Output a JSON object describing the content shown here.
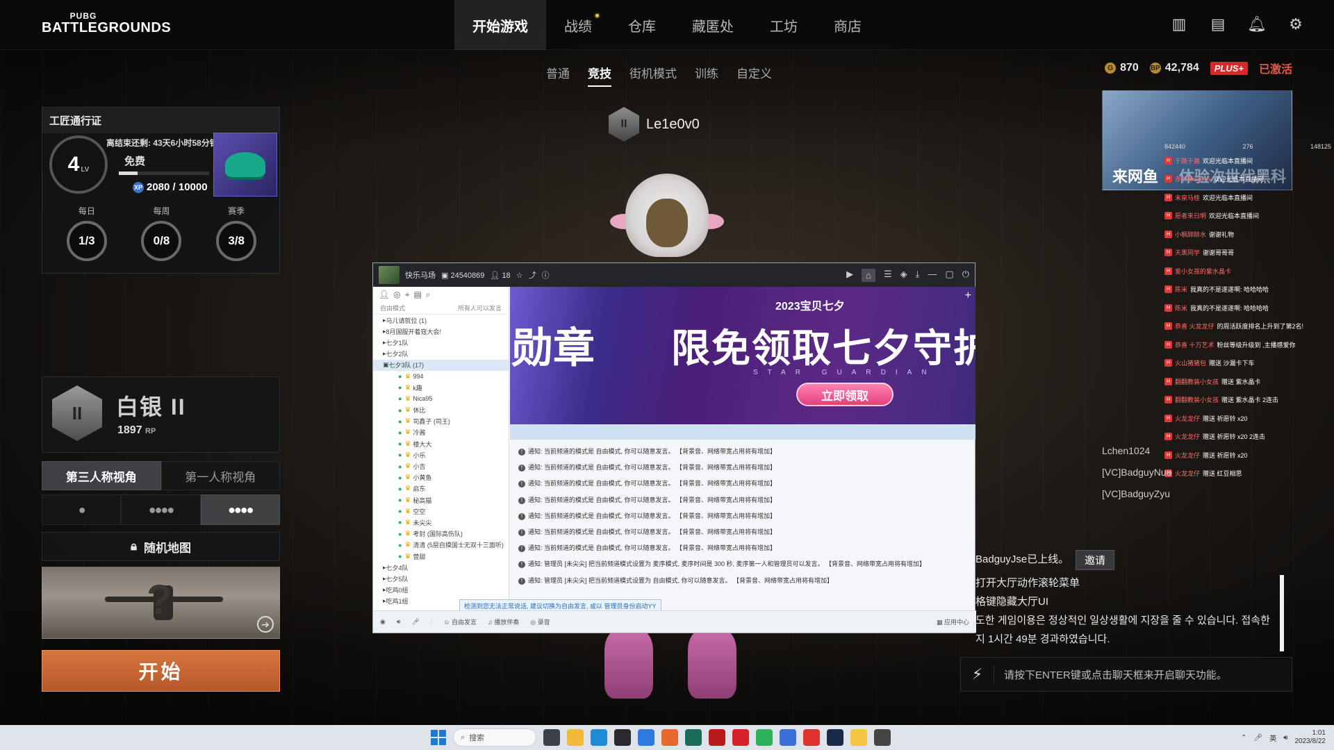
{
  "brand": {
    "line1": "PUBG",
    "line2": "BATTLEGROUNDS"
  },
  "nav": {
    "items": [
      {
        "label": "开始游戏",
        "active": true
      },
      {
        "label": "战绩",
        "active": false,
        "notify": true
      },
      {
        "label": "仓库",
        "active": false
      },
      {
        "label": "藏匿处",
        "active": false
      },
      {
        "label": "工坊",
        "active": false
      },
      {
        "label": "商店",
        "active": false
      }
    ]
  },
  "sub_nav": {
    "items": [
      "普通",
      "竞技",
      "街机模式",
      "训练",
      "自定义"
    ],
    "active": "竞技"
  },
  "top_icons": [
    "store-gift-icon",
    "missions-icon",
    "bell-icon",
    "gear-icon"
  ],
  "currency": {
    "gcoin": "870",
    "bp": "42,784",
    "plus_label": "PLUS+",
    "plus_status": "已激活"
  },
  "survivor_pass": {
    "title": "工匠通行证",
    "end_notice": "离结束还剩: 43天6小时58分钟",
    "level": "4",
    "level_suffix": "LV",
    "tier": "免费",
    "xp": "2080 / 10000",
    "xp_fraction": 0.208,
    "missions": [
      {
        "label": "每日",
        "progress": "1/3"
      },
      {
        "label": "每周",
        "progress": "0/8"
      },
      {
        "label": "赛季",
        "progress": "3/8"
      }
    ]
  },
  "player": {
    "name": "Le1e0v0",
    "emblem": "II"
  },
  "rank": {
    "tier": "白银 II",
    "emblem": "II",
    "rp": "1897",
    "rp_unit": "RP"
  },
  "perspective": {
    "options": [
      "第三人称视角",
      "第一人称视角"
    ],
    "active": "第三人称视角"
  },
  "squad": {
    "options": [
      "solo",
      "squad-4",
      "squad-4-active"
    ],
    "active_index": 2
  },
  "map": {
    "label": "随机地图"
  },
  "start": {
    "label": "开始"
  },
  "yy": {
    "title_bar": {
      "channel": "快乐马场",
      "id": "24540869",
      "members": "18"
    },
    "mode_left": "自由模式",
    "mode_right": "所有人可以发言",
    "tree": [
      {
        "text": "马儿请就位 (1)",
        "type": "group"
      },
      {
        "text": "8月国服开着寇大会!",
        "type": "group"
      },
      {
        "text": "七夕1队",
        "type": "group"
      },
      {
        "text": "七夕2队",
        "type": "group"
      },
      {
        "text": "七夕3队 (17)",
        "type": "group",
        "selected": true
      },
      {
        "text": "994",
        "type": "member"
      },
      {
        "text": "k趣",
        "type": "member"
      },
      {
        "text": "Nica95",
        "type": "member"
      },
      {
        "text": "休比",
        "type": "member"
      },
      {
        "text": "司鑫子 (司王)",
        "type": "member"
      },
      {
        "text": "冷酱",
        "type": "member"
      },
      {
        "text": "楼大大",
        "type": "member"
      },
      {
        "text": "小乐",
        "type": "member"
      },
      {
        "text": "小吉",
        "type": "member"
      },
      {
        "text": "小黄鱼",
        "type": "member"
      },
      {
        "text": "启东",
        "type": "member"
      },
      {
        "text": "秘高猫",
        "type": "member"
      },
      {
        "text": "空空",
        "type": "member"
      },
      {
        "text": "未尖尖",
        "type": "member"
      },
      {
        "text": "考封 (国际高伤队)",
        "type": "member"
      },
      {
        "text": "清清 (5层自摸国士无双十三面听)",
        "type": "member"
      },
      {
        "text": "营甜",
        "type": "member"
      },
      {
        "text": "七夕4队",
        "type": "group"
      },
      {
        "text": "七夕5队",
        "type": "group"
      },
      {
        "text": "吃鸡0组",
        "type": "group"
      },
      {
        "text": "吃鸡1组",
        "type": "group"
      }
    ],
    "banner": {
      "left_text": "勋章",
      "subtitle": "2023宝贝七夕",
      "headline": "限免领取七夕守护勋",
      "en": "STAR GUARDIAN",
      "button": "立即领取"
    },
    "notices": [
      "通知: 当前频道的模式是 自由模式, 你可以随意发言。 【背景音、网络带宽占用将有增加】",
      "通知: 当前频道的模式是 自由模式, 你可以随意发言。 【背景音、网络带宽占用将有增加】",
      "通知: 当前频道的模式是 自由模式, 你可以随意发言。 【背景音、网络带宽占用将有增加】",
      "通知: 当前频道的模式是 自由模式, 你可以随意发言。 【背景音、网络带宽占用将有增加】",
      "通知: 当前频道的模式是 自由模式, 你可以随意发言。 【背景音、网络带宽占用将有增加】",
      "通知: 当前频道的模式是 自由模式, 你可以随意发言。 【背景音、网络带宽占用将有增加】",
      "通知: 当前频道的模式是 自由模式, 你可以随意发言。 【背景音、网络带宽占用将有增加】",
      "通知: 管理员 [未尖尖] 把当前频道模式设置为 麦序模式, 麦序时间是 300 秒, 麦序第一人和管理员可以发言。 【背景音、网络带宽占用将有增加】",
      "通知: 管理员 [未尖尖] 把当前频道模式设置为 自由模式, 你可以随意发言。 【背景音、网络带宽占用将有增加】"
    ],
    "input_tip": "检测到您无法正常说话, 建议切换为自由发言, 或以 管理员身份启动YY",
    "bottom": {
      "free_talk": "自由发言",
      "music": "播放伴奏",
      "record": "录音",
      "app_center": "应用中心"
    }
  },
  "event_banner": {
    "title": "来网鱼",
    "title2": "体验次世代黑科技"
  },
  "danmaku": {
    "stats_left": "842440",
    "stats_mid": "276",
    "stats_right": "148125",
    "lines": [
      {
        "nick": "于路于路",
        "text": "欢迎光临本直播间"
      },
      {
        "nick": "赤熊赤SANA",
        "text": "欢迎光临本直播间"
      },
      {
        "nick": "末泉马桂",
        "text": "欢迎光临本直播间"
      },
      {
        "nick": "愿者来日明",
        "text": "欢迎光临本直播间"
      },
      {
        "nick": "小枫醉醉水",
        "text": "谢谢礼物"
      },
      {
        "nick": "天黑同学",
        "text": "谢谢哥哥哥"
      },
      {
        "nick": "爱小女孩的紫水晶卡",
        "text": ""
      },
      {
        "nick": "陈米",
        "text": "我真的不是遂遂啊: 哈哈哈哈"
      },
      {
        "nick": "陈米",
        "text": "我真的不是遂遂啊: 哈哈哈哈"
      },
      {
        "nick": "恭喜 火龙龙仔",
        "text": "的周活跃度排名上升到了第2名!"
      },
      {
        "nick": "恭喜 十万艺术",
        "text": "粉丝等级升级到 ,主播感爱你"
      },
      {
        "nick": "火山猪猪包",
        "text": "赠送 沙漏卡下车"
      },
      {
        "nick": "翻翻教装小女孩",
        "text": "赠送 紫水晶卡"
      },
      {
        "nick": "翻翻教装小女孩",
        "text": "赠送 紫水晶卡 2连击"
      },
      {
        "nick": "火龙龙仔",
        "text": "赠送 祈愿铃 x20"
      },
      {
        "nick": "火龙龙仔",
        "text": "赠送 祈愿铃 x20 2连击"
      },
      {
        "nick": "火龙龙仔",
        "text": "赠送 祈愿铃 x20"
      },
      {
        "nick": "火龙龙仔",
        "text": "赠送 红豆相思"
      }
    ]
  },
  "friends": [
    "Lchen1024",
    "[VC]BadguyNuo",
    "[VC]BadguyZyu"
  ],
  "chat": {
    "online": "BadguyJse已上线。",
    "invite": "邀请",
    "lines": [
      "打开大厅动作滚轮菜单",
      "格键隐藏大厅UI",
      "도한 게임이용은 정상적인 일상생활에 지장을 줄 수 있습니다. 접속한",
      "지 1시간 49분 경과하였습니다."
    ],
    "placeholder": "请按下ENTER键或点击聊天框来开启聊天功能。"
  },
  "taskbar": {
    "search": "搜索",
    "time": "1:01",
    "date": "2023/8/22",
    "lang": "英"
  }
}
